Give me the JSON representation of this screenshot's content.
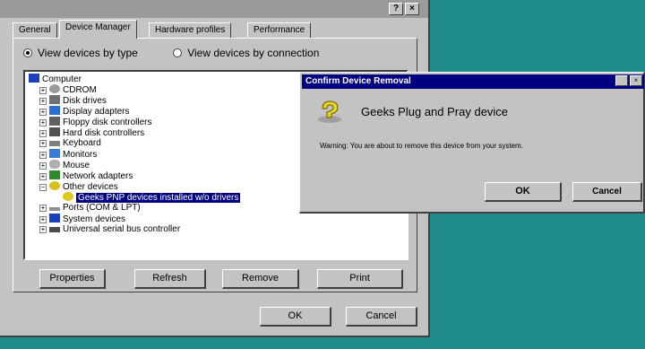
{
  "main_window": {
    "help_label": "?",
    "close_label": "×",
    "tabs": [
      {
        "label": "General"
      },
      {
        "label": "Device Manager"
      },
      {
        "label": "Hardware profiles"
      },
      {
        "label": "Performance"
      }
    ],
    "view_by_type": "View devices by type",
    "view_by_connection": "View devices by connection",
    "tree": [
      {
        "label": "Computer",
        "expander": ""
      },
      {
        "label": "CDROM",
        "expander": "+"
      },
      {
        "label": "Disk drives",
        "expander": "+"
      },
      {
        "label": "Display adapters",
        "expander": "+"
      },
      {
        "label": "Floppy disk controllers",
        "expander": "+"
      },
      {
        "label": "Hard disk controllers",
        "expander": "+"
      },
      {
        "label": "Keyboard",
        "expander": "+"
      },
      {
        "label": "Monitors",
        "expander": "+"
      },
      {
        "label": "Mouse",
        "expander": "+"
      },
      {
        "label": "Network adapters",
        "expander": "+"
      },
      {
        "label": "Other devices",
        "expander": "−"
      },
      {
        "label": "Geeks PNP devices installed w/o drivers",
        "expander": ""
      },
      {
        "label": "Ports (COM & LPT)",
        "expander": "+"
      },
      {
        "label": "System devices",
        "expander": "+"
      },
      {
        "label": "Universal serial bus controller",
        "expander": "+"
      }
    ],
    "buttons": {
      "properties": "Properties",
      "refresh": "Refresh",
      "remove": "Remove",
      "print": "Print",
      "ok": "OK",
      "cancel": "Cancel"
    }
  },
  "confirm_dialog": {
    "title": "Confirm Device Removal",
    "close_label": "×",
    "device_name": "Geeks Plug and Pray device",
    "warning": "Warning: You are about to remove this device from your system.",
    "ok": "OK",
    "cancel": "Cancel"
  },
  "colors": {
    "desktop": "#1f8a8a",
    "window_face": "#c3c3c3",
    "titlebar_active": "#000080",
    "selection": "#000080"
  }
}
